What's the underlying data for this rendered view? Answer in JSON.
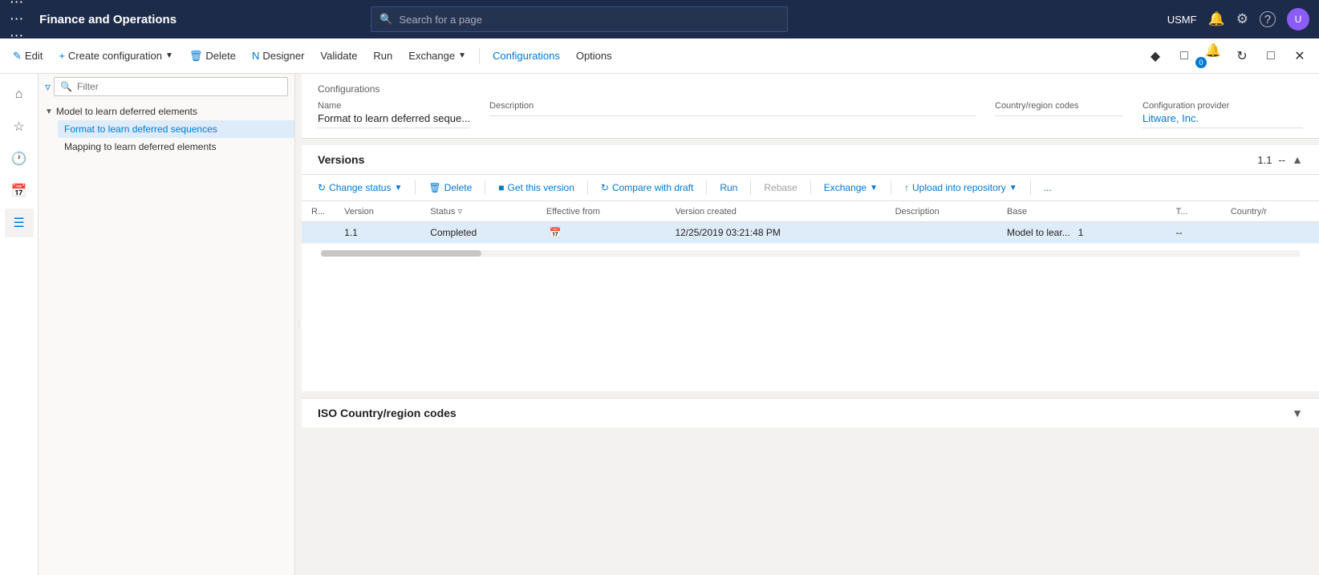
{
  "app": {
    "title": "Finance and Operations"
  },
  "search": {
    "placeholder": "Search for a page"
  },
  "topnav": {
    "user": "USMF"
  },
  "toolbar": {
    "edit": "Edit",
    "create_config": "Create configuration",
    "delete": "Delete",
    "designer": "Designer",
    "validate": "Validate",
    "run": "Run",
    "exchange": "Exchange",
    "configurations": "Configurations",
    "options": "Options"
  },
  "tree": {
    "parent": "Model to learn deferred elements",
    "items": [
      {
        "label": "Format to learn deferred sequences",
        "selected": true
      },
      {
        "label": "Mapping to learn deferred elements",
        "selected": false
      }
    ]
  },
  "config_section": {
    "title": "Configurations",
    "fields": {
      "name_label": "Name",
      "name_value": "Format to learn deferred seque...",
      "description_label": "Description",
      "description_value": "",
      "country_label": "Country/region codes",
      "country_value": "",
      "provider_label": "Configuration provider",
      "provider_value": "Litware, Inc."
    }
  },
  "versions": {
    "title": "Versions",
    "version_num": "1.1",
    "dash": "--",
    "toolbar": {
      "change_status": "Change status",
      "delete": "Delete",
      "get_version": "Get this version",
      "compare": "Compare with draft",
      "run": "Run",
      "rebase": "Rebase",
      "exchange": "Exchange",
      "upload": "Upload into repository",
      "more": "..."
    },
    "table": {
      "columns": [
        "R...",
        "Version",
        "Status",
        "Effective from",
        "Version created",
        "Description",
        "Base",
        "T...",
        "Country/r"
      ],
      "rows": [
        {
          "r": "",
          "version": "1.1",
          "status": "Completed",
          "effective_from": "",
          "version_created": "12/25/2019 03:21:48 PM",
          "description": "",
          "base": "Model to lear...",
          "base_num": "1",
          "t": "--",
          "country": ""
        }
      ]
    }
  },
  "iso_section": {
    "title": "ISO Country/region codes"
  },
  "icons": {
    "waffle": "⊞",
    "search": "🔍",
    "bell": "🔔",
    "gear": "⚙",
    "help": "?",
    "home": "⌂",
    "star": "☆",
    "clock": "🕐",
    "calendar": "📅",
    "list": "☰",
    "filter": "▽",
    "pencil": "✏",
    "plus": "+",
    "trash": "🗑",
    "chevron_down": "▾",
    "chevron_up": "▴",
    "arrow_left": "◄",
    "refresh": "↻",
    "compare": "⊞",
    "upload": "↑",
    "collapse": "▴",
    "expand": "▾",
    "more": "⋯",
    "diamond": "◆",
    "puzzle": "⊛",
    "notification_badge": "0"
  }
}
